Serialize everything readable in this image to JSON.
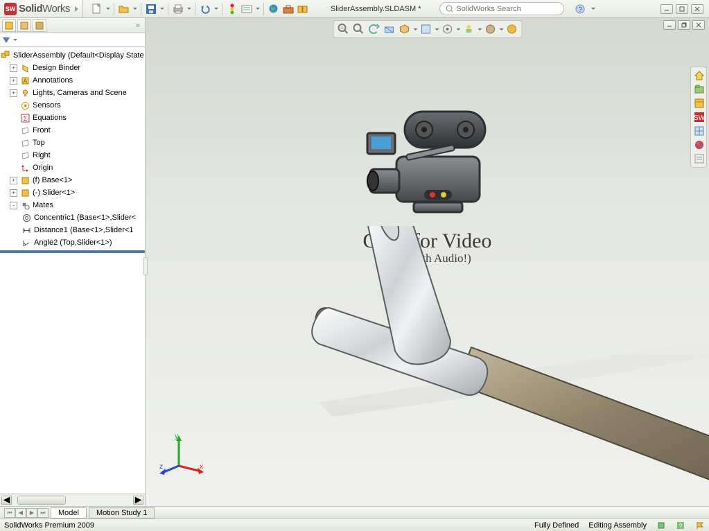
{
  "app": {
    "name_bold": "Solid",
    "name_thin": "Works"
  },
  "document": {
    "title": "SliderAssembly.SLDASM *"
  },
  "search": {
    "placeholder": "SolidWorks Search"
  },
  "overlay": {
    "line1": "Click for Video",
    "line2": "(now with Audio!)"
  },
  "tree": {
    "root": "SliderAssembly  (Default<Display State",
    "items": [
      {
        "label": "Design Binder",
        "exp": "+",
        "ico": "binder"
      },
      {
        "label": "Annotations",
        "exp": "+",
        "ico": "annot"
      },
      {
        "label": "Lights, Cameras and Scene",
        "exp": "+",
        "ico": "light"
      },
      {
        "label": "Sensors",
        "exp": "",
        "ico": "sensor"
      },
      {
        "label": "Equations",
        "exp": "",
        "ico": "eq"
      },
      {
        "label": "Front",
        "exp": "",
        "ico": "plane"
      },
      {
        "label": "Top",
        "exp": "",
        "ico": "plane"
      },
      {
        "label": "Right",
        "exp": "",
        "ico": "plane"
      },
      {
        "label": "Origin",
        "exp": "",
        "ico": "origin"
      },
      {
        "label": "(f) Base<1>",
        "exp": "+",
        "ico": "part"
      },
      {
        "label": "(-) Slider<1>",
        "exp": "+",
        "ico": "part"
      },
      {
        "label": "Mates",
        "exp": "-",
        "ico": "mates"
      }
    ],
    "mates": [
      {
        "label": "Concentric1 (Base<1>,Slider<",
        "ico": "concentric"
      },
      {
        "label": "Distance1 (Base<1>,Slider<1",
        "ico": "distance"
      },
      {
        "label": "Angle2 (Top,Slider<1>)",
        "ico": "angle"
      }
    ]
  },
  "bottom_tabs": {
    "t1": "Model",
    "t2": "Motion Study 1"
  },
  "status": {
    "product": "SolidWorks Premium 2009",
    "defined": "Fully Defined",
    "mode": "Editing Assembly"
  },
  "triad": {
    "x": "x",
    "y": "y",
    "z": "z"
  }
}
